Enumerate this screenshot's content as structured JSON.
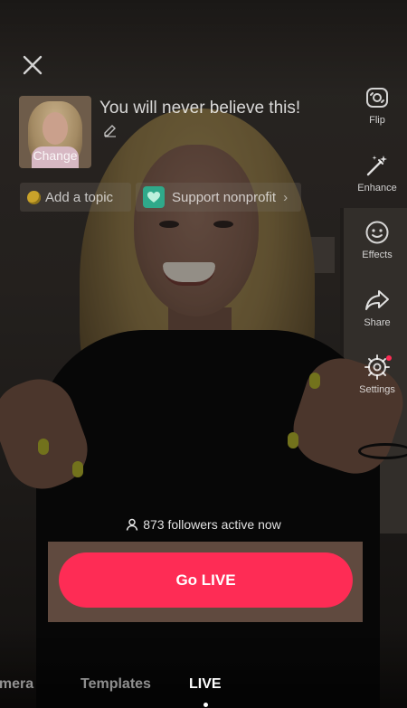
{
  "header": {
    "close_icon": "close-icon",
    "cover": {
      "label": "Change"
    },
    "title": "You will never believe this!",
    "edit_icon": "pencil-icon"
  },
  "chips": {
    "topic": {
      "label": "Add a topic",
      "icon": "coin-icon"
    },
    "nonprofit": {
      "label": "Support nonprofit",
      "icon": "heart-globe-icon"
    }
  },
  "tools": [
    {
      "label": "Flip",
      "icon": "flip-camera-icon"
    },
    {
      "label": "Enhance",
      "icon": "magic-wand-icon"
    },
    {
      "label": "Effects",
      "icon": "smiley-icon"
    },
    {
      "label": "Share",
      "icon": "share-arrow-icon"
    },
    {
      "label": "Settings",
      "icon": "gear-icon"
    }
  ],
  "followers_text": "873 followers active now",
  "go_live_label": "Go LIVE",
  "tabs": [
    {
      "label": "amera"
    },
    {
      "label": "Templates"
    },
    {
      "label": "LIVE",
      "active": true
    }
  ],
  "colors": {
    "accent": "#fe2c55",
    "nonprofit_logo": "#2fa98a",
    "coin": "#c9a22a"
  }
}
